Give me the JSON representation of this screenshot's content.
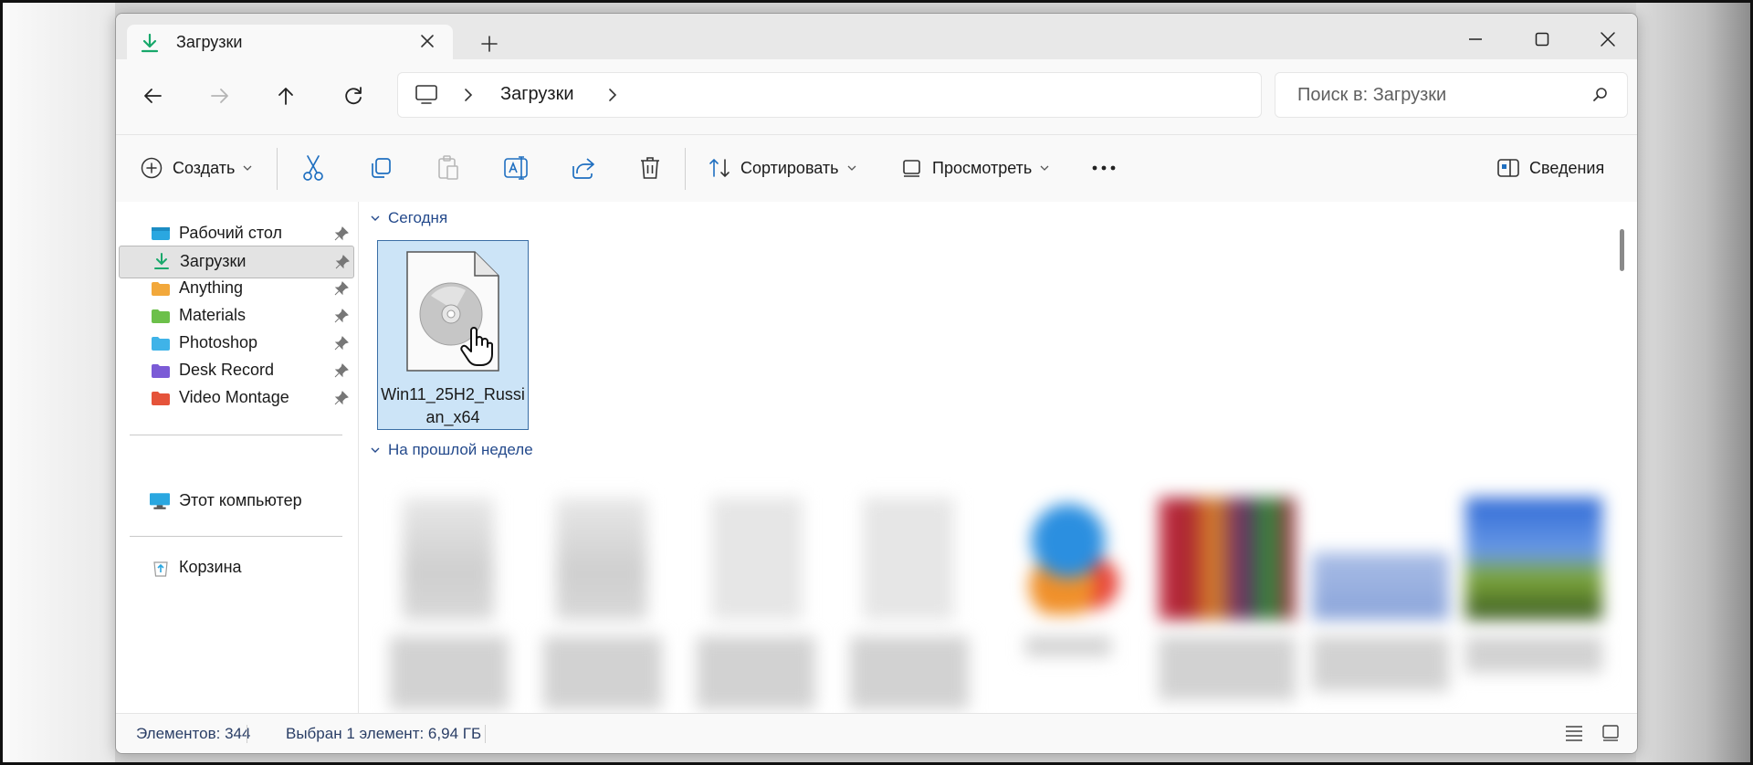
{
  "window": {
    "tab_title": "Загрузки"
  },
  "address": {
    "location": "Загрузки"
  },
  "search": {
    "placeholder": "Поиск в: Загрузки"
  },
  "toolbar": {
    "create_label": "Создать",
    "sort_label": "Сортировать",
    "view_label": "Просмотреть",
    "details_label": "Сведения"
  },
  "sidebar": {
    "pinned": [
      {
        "label": "Рабочий стол",
        "color": "#2aa7e0"
      },
      {
        "label": "Загрузки",
        "color": "#18a86b"
      },
      {
        "label": "Anything",
        "color": "#f2a83b"
      },
      {
        "label": "Materials",
        "color": "#6cc04a"
      },
      {
        "label": "Photoshop",
        "color": "#3fb3e8"
      },
      {
        "label": "Desk Record",
        "color": "#7b5bd6"
      },
      {
        "label": "Video Montage",
        "color": "#e5533a"
      }
    ],
    "this_pc": "Этот компьютер",
    "recycle_bin": "Корзина"
  },
  "content": {
    "group_today": "Сегодня",
    "group_last_week": "На прошлой неделе",
    "selected_file": {
      "name": "Win11_25H2_Russian_x64",
      "icon": "disc-image-icon"
    }
  },
  "status": {
    "items_count": "Элементов: 344",
    "selection": "Выбран 1 элемент: 6,94 ГБ"
  },
  "colors": {
    "accent": "#0067c0",
    "selection_bg": "#cce4f7",
    "group_text": "#244a8c"
  }
}
